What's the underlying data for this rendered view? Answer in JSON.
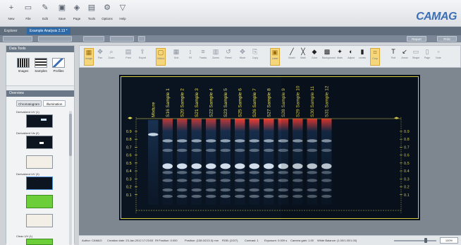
{
  "ribbon": {
    "items": [
      {
        "label": "New",
        "icon": "plus-icon"
      },
      {
        "label": "File",
        "icon": "file-icon"
      },
      {
        "label": "Edit",
        "icon": "edit-icon"
      },
      {
        "label": "Save",
        "icon": "save-icon"
      },
      {
        "label": "Page",
        "icon": "page-icon"
      },
      {
        "label": "Tools",
        "icon": "tools-icon"
      },
      {
        "label": "Options",
        "icon": "options-icon"
      },
      {
        "label": "Help",
        "icon": "help-icon"
      }
    ],
    "logo": "CAMAG"
  },
  "tabs": [
    {
      "label": "Explorer"
    },
    {
      "label": "Example Analysis 2.13 *"
    }
  ],
  "toolbar2": {
    "right_buttons": [
      "Report",
      "Print"
    ]
  },
  "left_panel": {
    "data_tools_title": "Data Tools",
    "tools": [
      "Images",
      "Samples",
      "Profiles"
    ],
    "overview_title": "Overview",
    "overview_tabs": [
      "Chromatogram",
      "Illumination"
    ],
    "thumbnails": [
      {
        "label": "Derivatized UV (1)",
        "style": "dark"
      },
      {
        "label": "Derivatized Vis (2)",
        "style": "dark"
      },
      {
        "label": "",
        "style": "light"
      },
      {
        "label": "Derivatized UV (3)",
        "style": "dark"
      },
      {
        "label": "",
        "style": "green"
      },
      {
        "label": "",
        "style": "light"
      },
      {
        "label": "Clean UV (1)",
        "style": "green"
      }
    ]
  },
  "image_tools": [
    {
      "label": "Image",
      "icon": "image-icon",
      "active": true
    },
    {
      "label": "Pan",
      "icon": "pan-icon"
    },
    {
      "label": "Zoom",
      "icon": "zoom-icon"
    },
    {
      "label": "Print",
      "icon": "print-icon"
    },
    {
      "label": "Export",
      "icon": "export-icon"
    },
    {
      "label": "Select",
      "icon": "select-icon",
      "active": true
    },
    {
      "label": "Grid",
      "icon": "grid-icon"
    },
    {
      "label": "Rf",
      "icon": "rf-icon"
    },
    {
      "label": "Tracks",
      "icon": "tracks-icon"
    },
    {
      "label": "Zones",
      "icon": "zones-icon"
    },
    {
      "label": "Reset",
      "icon": "reset-icon"
    },
    {
      "label": "Move",
      "icon": "move-icon"
    },
    {
      "label": "Copy",
      "icon": "copy-icon"
    },
    {
      "label": "Label",
      "icon": "label-icon",
      "active": true
    },
    {
      "label": "Brush",
      "icon": "brush-icon",
      "dark": true
    },
    {
      "label": "Mark",
      "icon": "mark-icon",
      "dark": true
    },
    {
      "label": "Color",
      "icon": "color-icon",
      "dark": true
    },
    {
      "label": "Background",
      "icon": "background-icon",
      "dark": true
    },
    {
      "label": "Mark",
      "icon": "mark2-icon",
      "dark": true
    },
    {
      "label": "Adjust",
      "icon": "adjust-icon",
      "dark": true
    },
    {
      "label": "Levels",
      "icon": "levels-icon",
      "dark": true
    },
    {
      "label": "Crop",
      "icon": "crop-icon",
      "active": true
    },
    {
      "label": "Text",
      "icon": "text-icon",
      "dark": true
    },
    {
      "label": "Arrow",
      "icon": "arrow-icon",
      "dark": true
    },
    {
      "label": "Shape",
      "icon": "shape-icon"
    },
    {
      "label": "Page",
      "icon": "page2-icon"
    },
    {
      "label": "Note",
      "icon": "note-icon"
    }
  ],
  "plate": {
    "track_labels": [
      "Mixture",
      "S16 Sample 1",
      "S20 Sample 2",
      "S21 Sample 3",
      "S22 Sample 4",
      "S23 Sample 5",
      "S25 Sample 6",
      "S26 Sample 7",
      "S27 Sample 8",
      "S28 Sample 9",
      "S29 Sample 10",
      "S30 Sample 11",
      "S31 Sample 12"
    ],
    "rf_ticks": [
      "0.9",
      "0.8",
      "0.7",
      "0.6",
      "0.5",
      "0.4",
      "0.3",
      "0.2",
      "0.1"
    ],
    "frame_color": "#d6c93a",
    "front_color": "#ff3b30",
    "band_color": "#e8f3ff"
  },
  "status": {
    "author": "Author: CAMAG",
    "creation": "Creation date: 23-Jan-2012 17:23:53",
    "rf_position": "Rf Position: 0.000",
    "position": "Position: (138.0/213.3) mm",
    "rgb": "RGB: (2/2/7)",
    "contrast": "Contrast: 1",
    "exposure": "Exposure: 0.009 s",
    "gain": "Camera gain: 1.00",
    "white_balance": "White Balance: (1.00/1.00/1.00)",
    "zoom": "100%"
  },
  "colors": {
    "accent": "#3b6fb6",
    "plate_bg": "#0a1320",
    "viewer_bg": "#7e868f"
  }
}
